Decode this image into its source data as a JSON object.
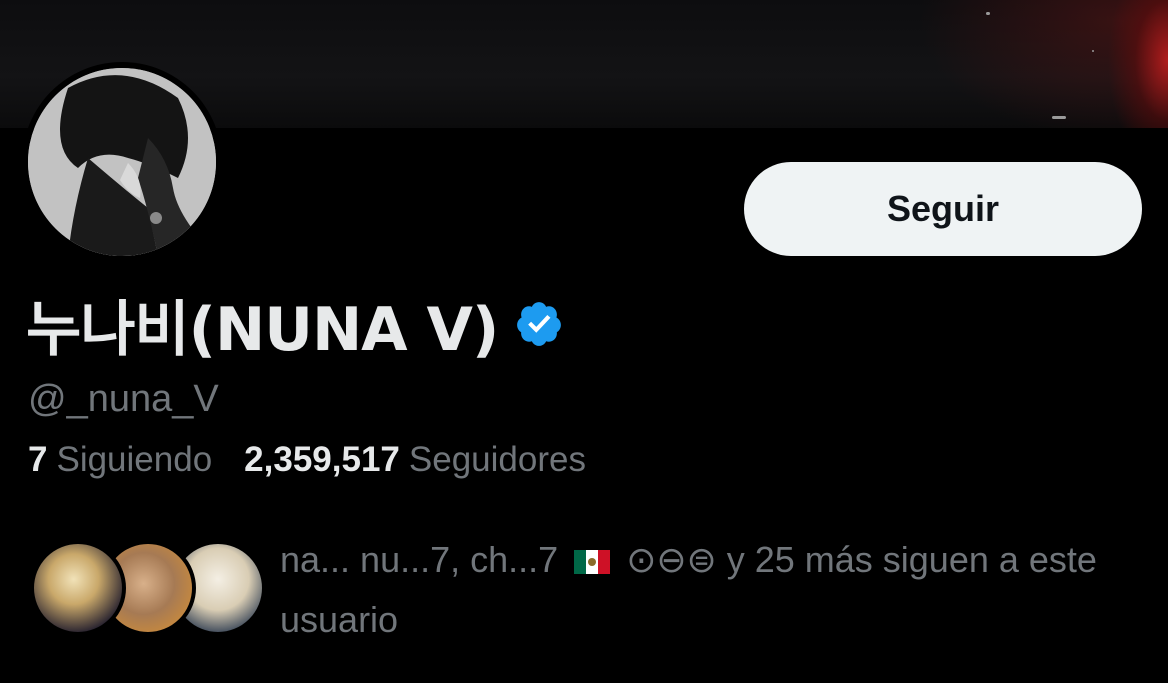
{
  "profile": {
    "display_name": "누나비(NUNA V)",
    "handle": "@_nuna_V",
    "verified": true,
    "follow_label": "Seguir"
  },
  "stats": {
    "following_count": "7",
    "following_label": "Siguiendo",
    "followers_count": "2,359,517",
    "followers_label": "Seguidores"
  },
  "followers_you_know": {
    "names_prefix": "na... nu...7, ch...7",
    "names_suffix": "⊙⊖⊜ y 25 más siguen a este usuario"
  },
  "icons": {
    "verified": "verified-badge-icon",
    "flag": "mexico-flag-icon"
  },
  "colors": {
    "background": "#000000",
    "primary_text": "#e7e9ea",
    "secondary_text": "#71767b",
    "follow_button_bg": "#eff3f4",
    "verified_blue": "#1d9bf0"
  }
}
